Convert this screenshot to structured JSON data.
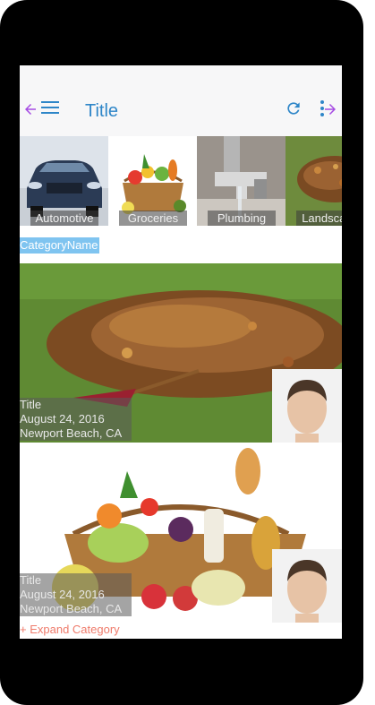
{
  "toolbar": {
    "title": "Title",
    "menu_icon": "hamburger-menu-icon",
    "refresh_icon": "refresh-icon",
    "more_icon": "more-vertical-icon",
    "accent_color": "#2e86c8"
  },
  "carousel": {
    "tiles": [
      {
        "label": "Automotive"
      },
      {
        "label": "Groceries"
      },
      {
        "label": "Plumbing"
      },
      {
        "label": "Landscape"
      }
    ],
    "arrow_color": "#a64ce3"
  },
  "category": {
    "name": "CategoryName"
  },
  "cards": [
    {
      "title": "Title",
      "date": "August 24, 2016",
      "location": "Newport Beach, CA"
    },
    {
      "title": "Title",
      "date": "August 24, 2016",
      "location": "Newport Beach, CA"
    }
  ],
  "expand_label": "+ Expand Category"
}
